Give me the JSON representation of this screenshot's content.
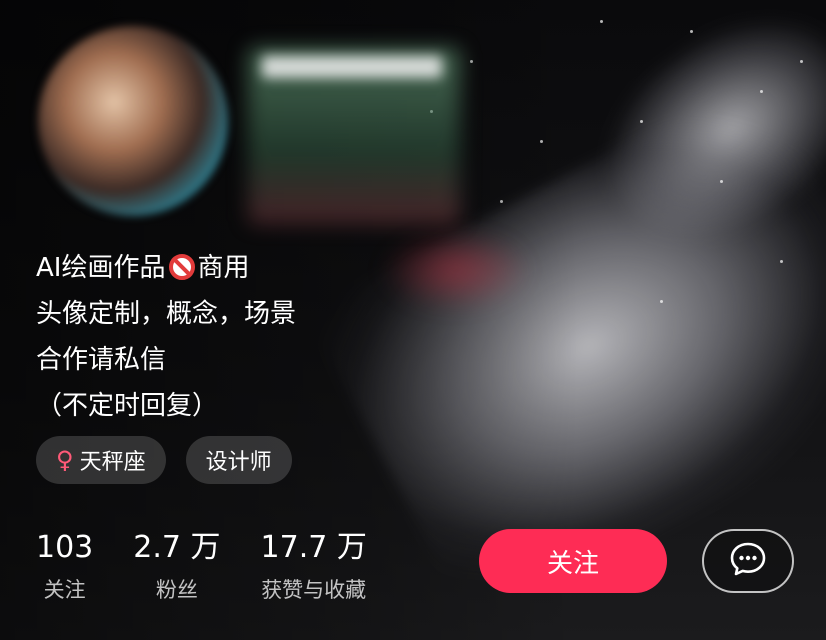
{
  "profile": {
    "bio_lines": [
      "AI绘画作品",
      "商用",
      "头像定制，概念，场景",
      "合作请私信",
      "（不定时回复）"
    ],
    "tags": [
      {
        "icon": "female-icon",
        "label": "天秤座"
      },
      {
        "label": "设计师"
      }
    ],
    "stats": [
      {
        "value": "103",
        "label": "关注"
      },
      {
        "value": "2.7 万",
        "label": "粉丝"
      },
      {
        "value": "17.7 万",
        "label": "获赞与收藏"
      }
    ]
  },
  "actions": {
    "follow_label": "关注",
    "chat_icon": "chat-bubble-icon"
  },
  "colors": {
    "accent": "#fe2c55",
    "no_icon_red": "#e23b3b",
    "female_icon": "#ff5a78"
  }
}
